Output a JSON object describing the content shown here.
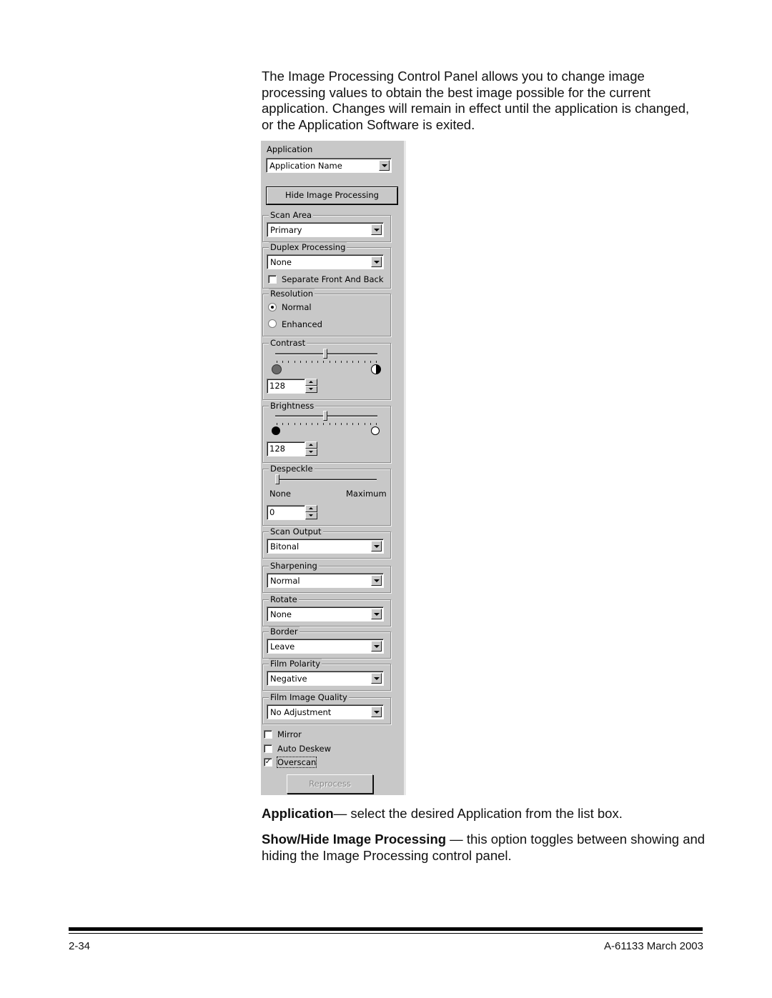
{
  "intro_text": "The Image Processing Control Panel allows you to change image processing values to obtain the best image possible for the current application. Changes will remain in effect until the application is changed, or the Application Software is exited.",
  "panel": {
    "application": {
      "label": "Application",
      "value": "Application Name"
    },
    "hide_button": "Hide Image Processing",
    "scan_area": {
      "label": "Scan Area",
      "value": "Primary"
    },
    "duplex": {
      "label": "Duplex Processing",
      "value": "None",
      "separate_label": "Separate Front And Back",
      "separate_checked": false
    },
    "resolution": {
      "label": "Resolution",
      "options": [
        "Normal",
        "Enhanced"
      ],
      "selected": "Normal"
    },
    "contrast": {
      "label": "Contrast",
      "value": "128",
      "min_icon": "contrast-low-icon",
      "max_icon": "contrast-high-icon",
      "level": 0.5
    },
    "brightness": {
      "label": "Brightness",
      "value": "128",
      "min_icon": "brightness-dark-icon",
      "max_icon": "brightness-light-icon",
      "level": 0.5
    },
    "despeckle": {
      "label": "Despeckle",
      "value": "0",
      "min_label": "None",
      "max_label": "Maximum",
      "level": 0
    },
    "scan_output": {
      "label": "Scan Output",
      "value": "Bitonal"
    },
    "sharpening": {
      "label": "Sharpening",
      "value": "Normal"
    },
    "rotate": {
      "label": "Rotate",
      "value": "None"
    },
    "border": {
      "label": "Border",
      "value": "Leave"
    },
    "film_polarity": {
      "label": "Film Polarity",
      "value": "Negative"
    },
    "film_image_quality": {
      "label": "Film Image Quality",
      "value": "No Adjustment"
    },
    "mirror": {
      "label": "Mirror",
      "checked": false
    },
    "auto_deskew": {
      "label": "Auto Deskew",
      "checked": false
    },
    "overscan": {
      "label": "Overscan",
      "checked": true
    },
    "reprocess_button": "Reprocess",
    "check_glyph": "✓"
  },
  "descriptions": [
    {
      "term": "Application",
      "sep": "— ",
      "text": "select the desired Application from the list box."
    },
    {
      "term": "Show/Hide Image Processing",
      "sep": " — ",
      "text": "this option toggles between showing and hiding the Image Processing control panel."
    }
  ],
  "footer": {
    "page": "2-34",
    "doc": "A-61133  March 2003"
  }
}
